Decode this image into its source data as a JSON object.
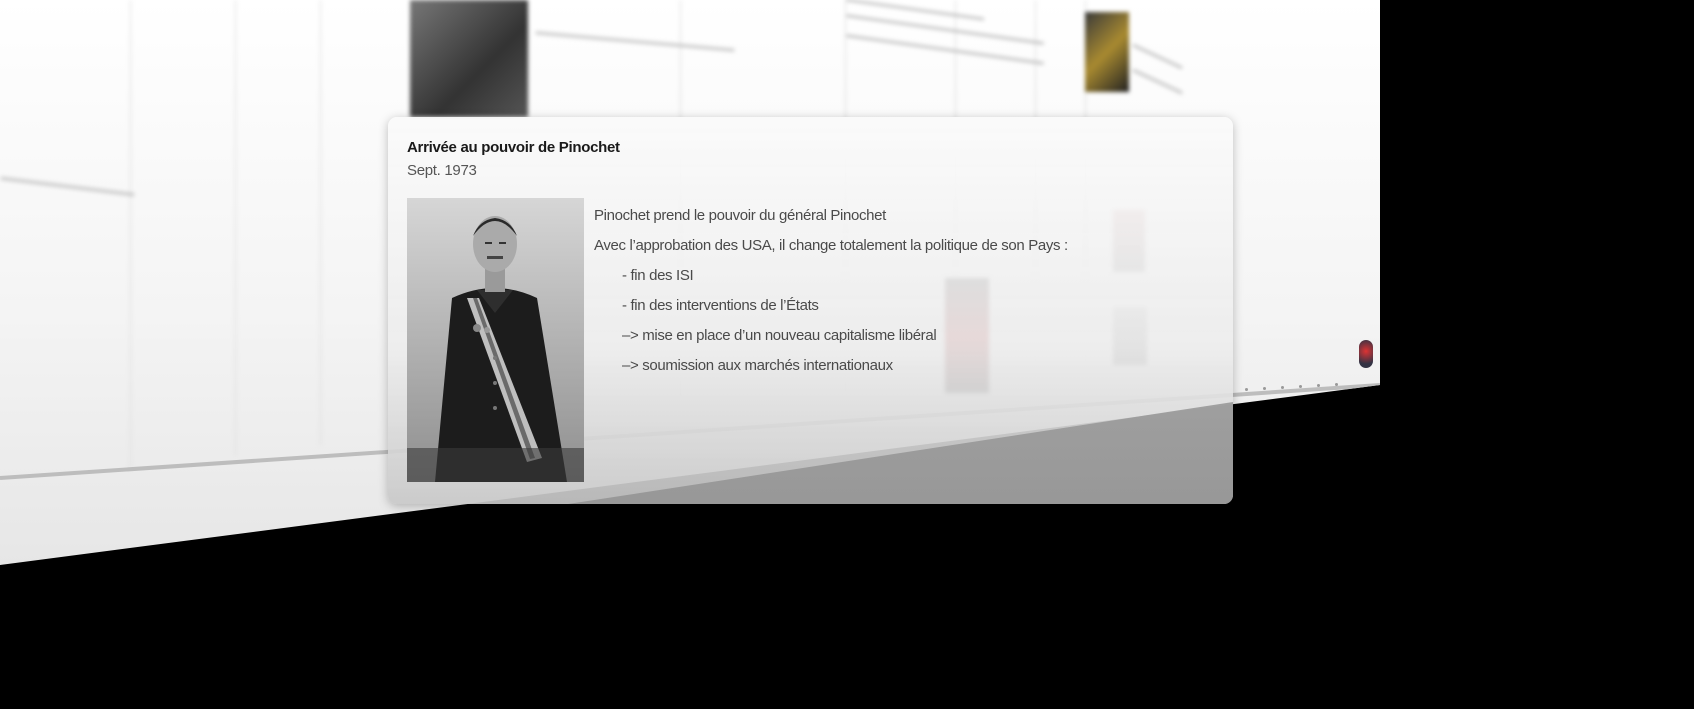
{
  "event": {
    "title": "Arrivée au pouvoir de Pinochet",
    "date": "Sept. 1973",
    "description_lines": [
      "Pinochet prend le pouvoir du général Pinochet",
      "Avec l’approbation des USA, il change totalement la politique de son Pays :"
    ],
    "bullets": [
      "- fin des ISI",
      "- fin des interventions de l’États",
      "–> mise en place d’un nouveau capitalisme libéral",
      "–> soumission aux marchés internationaux"
    ],
    "image": "portrait-photo"
  },
  "colors": {
    "background": "#000000",
    "card": "#f0f0f0",
    "title_text": "#1a1a1a",
    "body_text": "#4a4a4a"
  }
}
